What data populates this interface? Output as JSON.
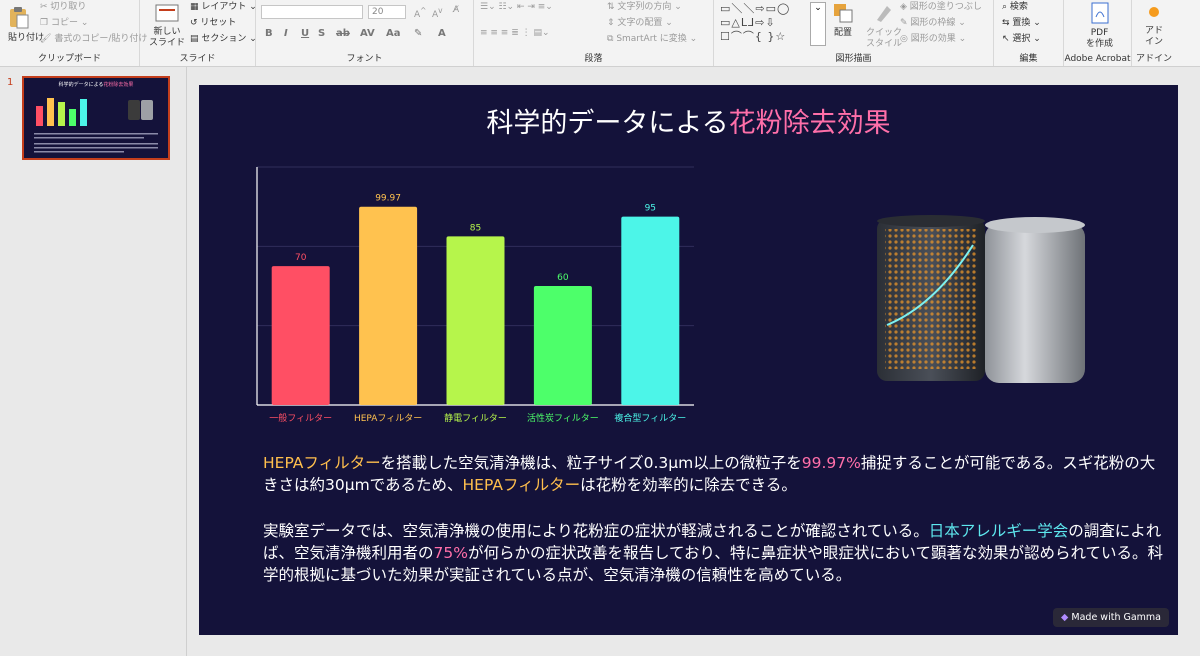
{
  "ribbon": {
    "clipboard": {
      "paste": "貼り付け",
      "cut": "切り取り",
      "copy": "コピー",
      "format_painter": "書式のコピー/貼り付け",
      "label": "クリップボード"
    },
    "slides": {
      "new_slide": "新しい",
      "new_slide2": "スライド",
      "layout": "レイアウト",
      "reset": "リセット",
      "section": "セクション",
      "label": "スライド"
    },
    "font": {
      "size": "20",
      "label": "フォント"
    },
    "paragraph": {
      "text_direction": "文字列の方向",
      "align_text": "文字の配置",
      "smartart": "SmartArt に変換",
      "label": "段落"
    },
    "drawing": {
      "arrange": "配置",
      "quick_styles": "クイック",
      "quick_styles2": "スタイル",
      "shape_fill": "図形の塗りつぶし",
      "shape_outline": "図形の枠線",
      "shape_effects": "図形の効果",
      "label": "図形描画"
    },
    "editing": {
      "find": "検索",
      "replace": "置換",
      "select": "選択",
      "label": "編集"
    },
    "acrobat": {
      "create_pdf": "PDF",
      "create_pdf2": "を作成",
      "label": "Adobe Acrobat"
    },
    "addins": {
      "addins": "アド",
      "addins2": "イン",
      "label": "アドイン"
    }
  },
  "thumbnails": [
    {
      "number": "1"
    }
  ],
  "slide": {
    "title_main": "科学的データによる",
    "title_highlight": "花粉除去効果",
    "para1": {
      "s1": "HEPAフィルター",
      "s2": "を搭載した空気清浄機は、粒子サイズ0.3μm以上の微粒子を",
      "s3": "99.97%",
      "s4": "捕捉することが可能である。スギ花粉の大きさは約30μmであるため、",
      "s5": "HEPAフィルター",
      "s6": "は花粉を効率的に除去できる。"
    },
    "para2": {
      "s1": "実験室データでは、空気清浄機の使用により花粉症の症状が軽減されることが確認されている。",
      "s2": "日本アレルギー学会",
      "s3": "の調査によれば、空気清浄機利用者の",
      "s4": "75%",
      "s5": "が何らかの症状改善を報告しており、特に鼻症状や眼症状において顕著な効果が認められている。科学的根拠に基づいた効果が実証されている点が、空気清浄機の信頼性を高めている。"
    },
    "badge": "Made with Gamma"
  },
  "chart_data": {
    "type": "bar",
    "categories": [
      "一般フィルター",
      "HEPAフィルター",
      "静電フィルター",
      "活性炭フィルター",
      "複合型フィルター"
    ],
    "values": [
      70,
      99.97,
      85,
      60,
      95
    ],
    "value_labels": [
      "70",
      "99.97",
      "85",
      "60",
      "95"
    ],
    "colors": [
      "#ff4f64",
      "#ffc24f",
      "#b6f54b",
      "#4dff6a",
      "#4cf5e8"
    ],
    "ylim": [
      0,
      120
    ],
    "grid": true,
    "title": "",
    "xlabel": "",
    "ylabel": ""
  }
}
